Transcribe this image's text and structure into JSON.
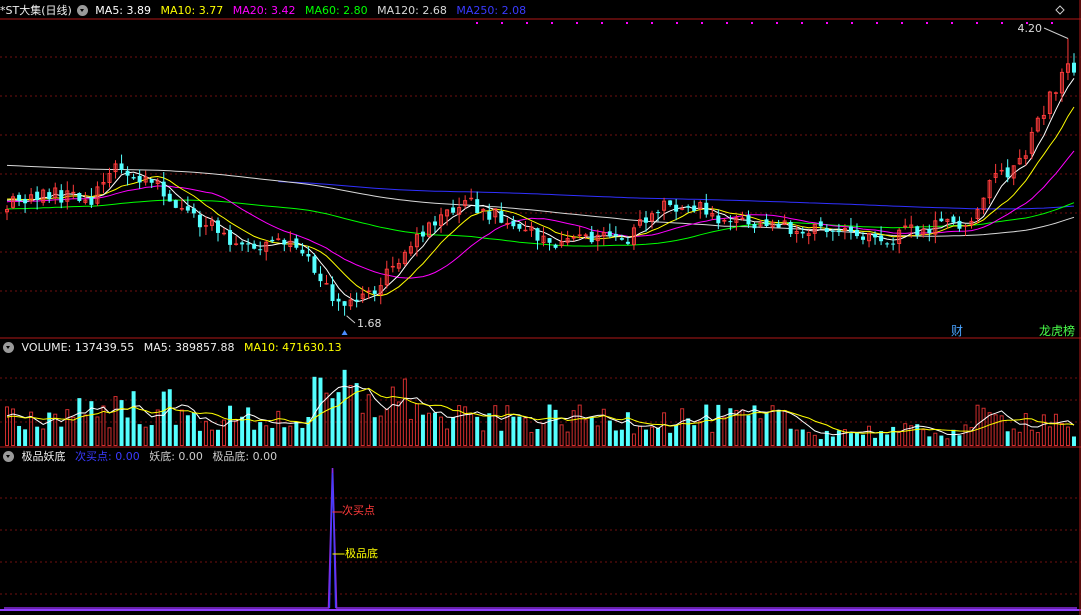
{
  "main_header": {
    "title": "*ST大集(日线)",
    "ma5": "MA5: 3.89",
    "ma10": "MA10: 3.77",
    "ma20": "MA20: 3.42",
    "ma60": "MA60: 2.80",
    "ma120": "MA120: 2.68",
    "ma250": "MA250: 2.08"
  },
  "volume_header": {
    "title": "VOLUME: 137439.55",
    "ma5": "MA5: 389857.88",
    "ma10": "MA10: 471630.13"
  },
  "indicator_header": {
    "title": "极品妖底",
    "buy": "次买点: 0.00",
    "yao": "妖底: 0.00",
    "jipin": "极品底: 0.00"
  },
  "annotations": {
    "high": "4.20",
    "low": "1.68",
    "cai_tag": "财",
    "long_tag": "龙虎榜",
    "buy_label": "次买点",
    "jipin_label": "极品底"
  },
  "colors": {
    "up": "#ff3b3b",
    "down": "#54ffff",
    "ma5": "#ffffff",
    "ma10": "#ffff00",
    "ma20": "#ff00ff",
    "ma60": "#00ff00",
    "ma120": "#d8d8d8",
    "ma250": "#3030ff",
    "indicator": "#8a2be2"
  },
  "chart_data": [
    {
      "type": "candlestick",
      "name": "price",
      "ylim": [
        1.55,
        4.35
      ],
      "x_count": 178,
      "high": {
        "index": 176,
        "value": 4.2
      },
      "low": {
        "index": 56,
        "value": 1.68
      },
      "close_anchors": [
        [
          0,
          2.72
        ],
        [
          8,
          2.78
        ],
        [
          14,
          2.75
        ],
        [
          18,
          3.05
        ],
        [
          25,
          2.85
        ],
        [
          30,
          2.62
        ],
        [
          35,
          2.45
        ],
        [
          40,
          2.3
        ],
        [
          45,
          2.35
        ],
        [
          50,
          2.22
        ],
        [
          54,
          1.85
        ],
        [
          58,
          1.78
        ],
        [
          62,
          2.0
        ],
        [
          66,
          2.3
        ],
        [
          72,
          2.55
        ],
        [
          76,
          2.72
        ],
        [
          80,
          2.62
        ],
        [
          86,
          2.5
        ],
        [
          90,
          2.35
        ],
        [
          94,
          2.38
        ],
        [
          98,
          2.42
        ],
        [
          102,
          2.35
        ],
        [
          106,
          2.55
        ],
        [
          110,
          2.7
        ],
        [
          114,
          2.68
        ],
        [
          118,
          2.55
        ],
        [
          124,
          2.52
        ],
        [
          130,
          2.48
        ],
        [
          136,
          2.48
        ],
        [
          140,
          2.42
        ],
        [
          145,
          2.35
        ],
        [
          150,
          2.45
        ],
        [
          155,
          2.52
        ],
        [
          160,
          2.55
        ],
        [
          164,
          2.95
        ],
        [
          168,
          3.05
        ],
        [
          172,
          3.55
        ],
        [
          176,
          3.95
        ],
        [
          177,
          3.89
        ]
      ],
      "ma_series": [
        {
          "name": "MA5",
          "last": 3.89
        },
        {
          "name": "MA10",
          "last": 3.77
        },
        {
          "name": "MA20",
          "last": 3.42
        },
        {
          "name": "MA60",
          "last": 2.8
        },
        {
          "name": "MA120",
          "last": 2.68
        },
        {
          "name": "MA250",
          "last": 2.08
        }
      ]
    },
    {
      "type": "bar",
      "name": "volume",
      "ylim": [
        0,
        1300000
      ],
      "last": 137439.55,
      "ma_series": [
        {
          "name": "MA5",
          "last": 389857.88
        },
        {
          "name": "MA10",
          "last": 471630.13
        }
      ]
    },
    {
      "type": "line",
      "name": "极品妖底",
      "ylim": [
        0,
        1
      ],
      "spike_index": 54,
      "values": {
        "次买点": 0.0,
        "妖底": 0.0,
        "极品底": 0.0
      }
    }
  ]
}
